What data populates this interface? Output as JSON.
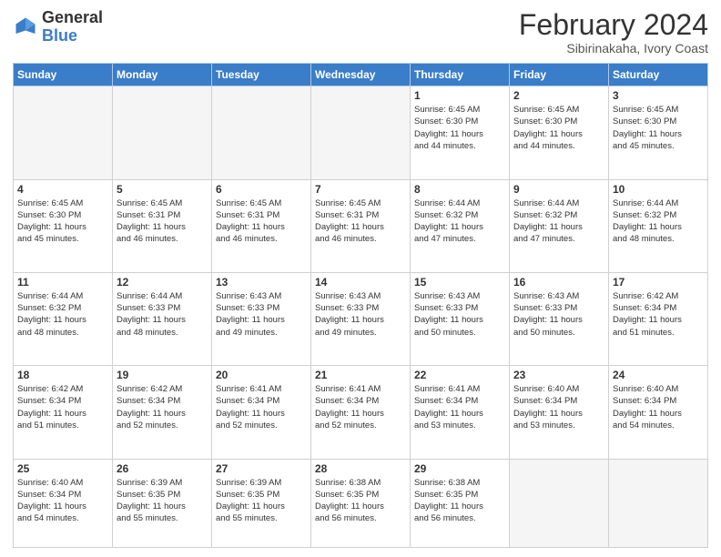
{
  "header": {
    "logo_general": "General",
    "logo_blue": "Blue",
    "month_title": "February 2024",
    "subtitle": "Sibirinakaha, Ivory Coast"
  },
  "days_of_week": [
    "Sunday",
    "Monday",
    "Tuesday",
    "Wednesday",
    "Thursday",
    "Friday",
    "Saturday"
  ],
  "weeks": [
    [
      {
        "day": "",
        "info": ""
      },
      {
        "day": "",
        "info": ""
      },
      {
        "day": "",
        "info": ""
      },
      {
        "day": "",
        "info": ""
      },
      {
        "day": "1",
        "info": "Sunrise: 6:45 AM\nSunset: 6:30 PM\nDaylight: 11 hours\nand 44 minutes."
      },
      {
        "day": "2",
        "info": "Sunrise: 6:45 AM\nSunset: 6:30 PM\nDaylight: 11 hours\nand 44 minutes."
      },
      {
        "day": "3",
        "info": "Sunrise: 6:45 AM\nSunset: 6:30 PM\nDaylight: 11 hours\nand 45 minutes."
      }
    ],
    [
      {
        "day": "4",
        "info": "Sunrise: 6:45 AM\nSunset: 6:30 PM\nDaylight: 11 hours\nand 45 minutes."
      },
      {
        "day": "5",
        "info": "Sunrise: 6:45 AM\nSunset: 6:31 PM\nDaylight: 11 hours\nand 46 minutes."
      },
      {
        "day": "6",
        "info": "Sunrise: 6:45 AM\nSunset: 6:31 PM\nDaylight: 11 hours\nand 46 minutes."
      },
      {
        "day": "7",
        "info": "Sunrise: 6:45 AM\nSunset: 6:31 PM\nDaylight: 11 hours\nand 46 minutes."
      },
      {
        "day": "8",
        "info": "Sunrise: 6:44 AM\nSunset: 6:32 PM\nDaylight: 11 hours\nand 47 minutes."
      },
      {
        "day": "9",
        "info": "Sunrise: 6:44 AM\nSunset: 6:32 PM\nDaylight: 11 hours\nand 47 minutes."
      },
      {
        "day": "10",
        "info": "Sunrise: 6:44 AM\nSunset: 6:32 PM\nDaylight: 11 hours\nand 48 minutes."
      }
    ],
    [
      {
        "day": "11",
        "info": "Sunrise: 6:44 AM\nSunset: 6:32 PM\nDaylight: 11 hours\nand 48 minutes."
      },
      {
        "day": "12",
        "info": "Sunrise: 6:44 AM\nSunset: 6:33 PM\nDaylight: 11 hours\nand 48 minutes."
      },
      {
        "day": "13",
        "info": "Sunrise: 6:43 AM\nSunset: 6:33 PM\nDaylight: 11 hours\nand 49 minutes."
      },
      {
        "day": "14",
        "info": "Sunrise: 6:43 AM\nSunset: 6:33 PM\nDaylight: 11 hours\nand 49 minutes."
      },
      {
        "day": "15",
        "info": "Sunrise: 6:43 AM\nSunset: 6:33 PM\nDaylight: 11 hours\nand 50 minutes."
      },
      {
        "day": "16",
        "info": "Sunrise: 6:43 AM\nSunset: 6:33 PM\nDaylight: 11 hours\nand 50 minutes."
      },
      {
        "day": "17",
        "info": "Sunrise: 6:42 AM\nSunset: 6:34 PM\nDaylight: 11 hours\nand 51 minutes."
      }
    ],
    [
      {
        "day": "18",
        "info": "Sunrise: 6:42 AM\nSunset: 6:34 PM\nDaylight: 11 hours\nand 51 minutes."
      },
      {
        "day": "19",
        "info": "Sunrise: 6:42 AM\nSunset: 6:34 PM\nDaylight: 11 hours\nand 52 minutes."
      },
      {
        "day": "20",
        "info": "Sunrise: 6:41 AM\nSunset: 6:34 PM\nDaylight: 11 hours\nand 52 minutes."
      },
      {
        "day": "21",
        "info": "Sunrise: 6:41 AM\nSunset: 6:34 PM\nDaylight: 11 hours\nand 52 minutes."
      },
      {
        "day": "22",
        "info": "Sunrise: 6:41 AM\nSunset: 6:34 PM\nDaylight: 11 hours\nand 53 minutes."
      },
      {
        "day": "23",
        "info": "Sunrise: 6:40 AM\nSunset: 6:34 PM\nDaylight: 11 hours\nand 53 minutes."
      },
      {
        "day": "24",
        "info": "Sunrise: 6:40 AM\nSunset: 6:34 PM\nDaylight: 11 hours\nand 54 minutes."
      }
    ],
    [
      {
        "day": "25",
        "info": "Sunrise: 6:40 AM\nSunset: 6:34 PM\nDaylight: 11 hours\nand 54 minutes."
      },
      {
        "day": "26",
        "info": "Sunrise: 6:39 AM\nSunset: 6:35 PM\nDaylight: 11 hours\nand 55 minutes."
      },
      {
        "day": "27",
        "info": "Sunrise: 6:39 AM\nSunset: 6:35 PM\nDaylight: 11 hours\nand 55 minutes."
      },
      {
        "day": "28",
        "info": "Sunrise: 6:38 AM\nSunset: 6:35 PM\nDaylight: 11 hours\nand 56 minutes."
      },
      {
        "day": "29",
        "info": "Sunrise: 6:38 AM\nSunset: 6:35 PM\nDaylight: 11 hours\nand 56 minutes."
      },
      {
        "day": "",
        "info": ""
      },
      {
        "day": "",
        "info": ""
      }
    ]
  ]
}
